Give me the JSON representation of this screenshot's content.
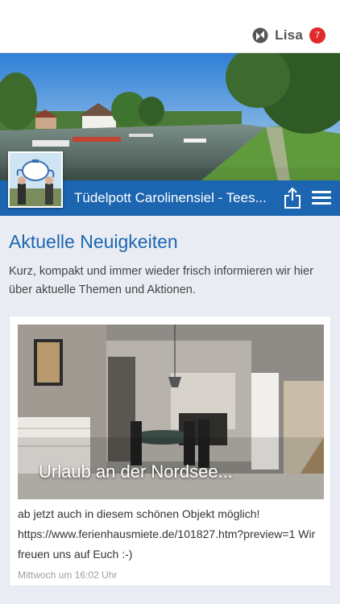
{
  "header": {
    "user_name": "Lisa",
    "notification_count": "7",
    "badge_color": "#e02b2b"
  },
  "titlebar": {
    "title": "Tüdelpott Carolinensiel - Tees...",
    "color": "#1c65b0"
  },
  "hero": {
    "logo_icon": "teapot-logo"
  },
  "news": {
    "heading": "Aktuelle Neuigkeiten",
    "intro": "Kurz, kompakt und immer wieder frisch informieren wir hier über aktuelle Themen und Aktionen.",
    "posts": [
      {
        "image_caption": "Urlaub an der Nordsee...",
        "text_line1": "ab jetzt auch in diesem schönen Objekt möglich!",
        "text_line2": "https://www.ferienhausmiete.de/101827.htm?preview=1 Wir",
        "text_line3": "freuen uns auf Euch :-)",
        "time": "Mittwoch um 16:02 Uhr"
      }
    ]
  }
}
